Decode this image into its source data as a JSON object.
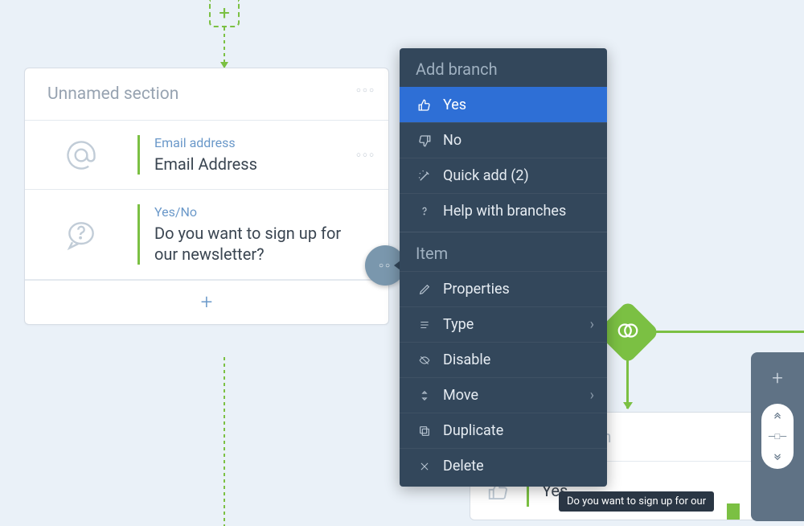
{
  "section": {
    "title": "Unnamed section",
    "items": [
      {
        "type_label": "Email address",
        "title": "Email Address",
        "icon": "at"
      },
      {
        "type_label": "Yes/No",
        "title": "Do you want to sign up for our newsletter?",
        "icon": "question-bubble"
      }
    ]
  },
  "context_menu": {
    "section1_title": "Add branch",
    "branch_yes": "Yes",
    "branch_no": "No",
    "quick_add": "Quick add (2)",
    "help": "Help with branches",
    "section2_title": "Item",
    "properties": "Properties",
    "type": "Type",
    "disable": "Disable",
    "move": "Move",
    "duplicate": "Duplicate",
    "delete": "Delete"
  },
  "branch_card": {
    "title": "Unnamed branch",
    "row_label": "Yes"
  },
  "tooltip": {
    "text": "Do you want to sign up for our"
  },
  "colors": {
    "accent_green": "#7bc043",
    "menu_bg": "#33475b",
    "selected_blue": "#2e6fd6"
  }
}
